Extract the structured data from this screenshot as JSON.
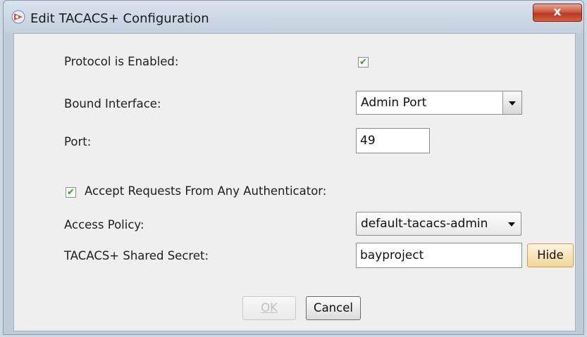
{
  "window": {
    "title": "Edit TACACS+ Configuration",
    "close_label": "x"
  },
  "form": {
    "protocol_enabled_label": "Protocol is Enabled:",
    "protocol_enabled_checked": true,
    "bound_interface_label": "Bound Interface:",
    "bound_interface_value": "Admin Port",
    "port_label": "Port:",
    "port_value": "49",
    "accept_any_label": "Accept Requests From Any Authenticator:",
    "accept_any_checked": true,
    "access_policy_label": "Access Policy:",
    "access_policy_value": "default-tacacs-admin",
    "shared_secret_label": "TACACS+ Shared Secret:",
    "shared_secret_value": "bayproject",
    "hide_label": "Hide"
  },
  "footer": {
    "ok_label": "OK",
    "cancel_label": "Cancel"
  },
  "icons": {
    "app": "tacacs-app-icon",
    "close": "close-icon",
    "check": "checkmark-icon",
    "dropdown": "chevron-down-icon"
  },
  "colors": {
    "close_red": "#c8462d",
    "check_green": "#2aa52a",
    "hide_highlight": "#f2d69a"
  }
}
